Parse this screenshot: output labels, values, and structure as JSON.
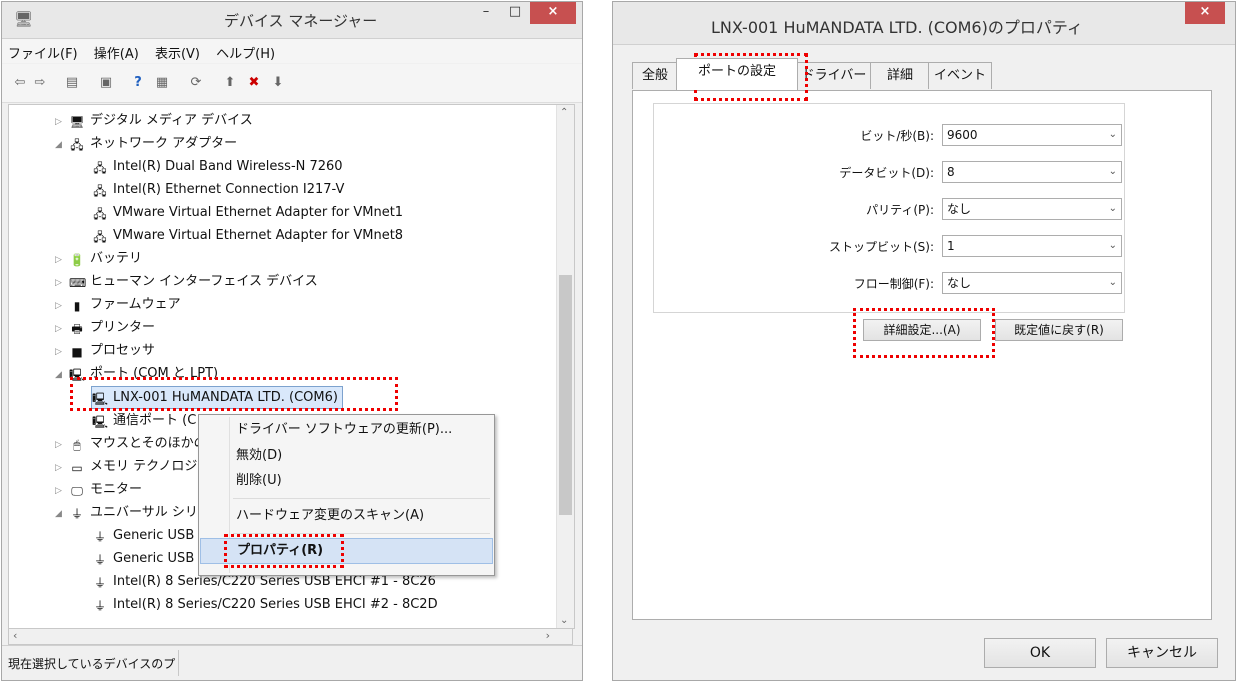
{
  "devmgr": {
    "title": "デバイス マネージャー",
    "min": "–",
    "max": "□",
    "close": "×",
    "menu": [
      "ファイル(F)",
      "操作(A)",
      "表示(V)",
      "ヘルプ(H)"
    ],
    "tree": [
      {
        "label": "デジタル メディア デバイス",
        "exp": "▷",
        "icon": "🖥"
      },
      {
        "label": "ネットワーク アダプター",
        "exp": "◢",
        "icon": "🖧"
      },
      {
        "label": "Intel(R) Dual Band Wireless-N 7260",
        "exp": "",
        "icon": "🖧"
      },
      {
        "label": "Intel(R) Ethernet Connection I217-V",
        "exp": "",
        "icon": "🖧"
      },
      {
        "label": "VMware Virtual Ethernet Adapter for VMnet1",
        "exp": "",
        "icon": "🖧"
      },
      {
        "label": "VMware Virtual Ethernet Adapter for VMnet8",
        "exp": "",
        "icon": "🖧"
      },
      {
        "label": "バッテリ",
        "exp": "▷",
        "icon": "🔋"
      },
      {
        "label": "ヒューマン インターフェイス デバイス",
        "exp": "▷",
        "icon": "⌨"
      },
      {
        "label": "ファームウェア",
        "exp": "▷",
        "icon": "▮"
      },
      {
        "label": "プリンター",
        "exp": "▷",
        "icon": "🖶"
      },
      {
        "label": "プロセッサ",
        "exp": "▷",
        "icon": "■"
      },
      {
        "label": "ポート (COM と LPT)",
        "exp": "◢",
        "icon": "🖳"
      },
      {
        "label": "LNX-001 HuMANDATA LTD. (COM6)",
        "exp": "",
        "icon": "🖳"
      },
      {
        "label": "通信ポート (C",
        "exp": "",
        "icon": "🖳"
      },
      {
        "label": "マウスとそのほかの",
        "exp": "▷",
        "icon": "🖱"
      },
      {
        "label": "メモリ テクノロジ デ",
        "exp": "▷",
        "icon": "▭"
      },
      {
        "label": "モニター",
        "exp": "▷",
        "icon": "🖵"
      },
      {
        "label": "ユニバーサル シリア",
        "exp": "◢",
        "icon": "⏚"
      },
      {
        "label": "Generic USB",
        "exp": "",
        "icon": "⏚"
      },
      {
        "label": "Generic USB Hub",
        "exp": "",
        "icon": "⏚"
      },
      {
        "label": "Intel(R) 8 Series/C220 Series USB EHCI #1 - 8C26",
        "exp": "",
        "icon": "⏚"
      },
      {
        "label": "Intel(R) 8 Series/C220 Series USB EHCI #2 - 8C2D",
        "exp": "",
        "icon": "⏚"
      }
    ],
    "context_menu": [
      "ドライバー ソフトウェアの更新(P)...",
      "無効(D)",
      "削除(U)",
      "ハードウェア変更のスキャン(A)",
      "プロパティ(R)"
    ],
    "status": "現在選択しているデバイスのプ"
  },
  "props": {
    "title": "LNX-001 HuMANDATA LTD. (COM6)のプロパティ",
    "close": "×",
    "tabs": [
      "全般",
      "ポートの設定",
      "ドライバー",
      "詳細",
      "イベント"
    ],
    "fields": [
      {
        "label": "ビット/秒(B):",
        "value": "9600"
      },
      {
        "label": "データビット(D):",
        "value": "8"
      },
      {
        "label": "パリティ(P):",
        "value": "なし"
      },
      {
        "label": "ストップビット(S):",
        "value": "1"
      },
      {
        "label": "フロー制御(F):",
        "value": "なし"
      }
    ],
    "advanced": "詳細設定...(A)",
    "defaults": "既定値に戻す(R)",
    "ok": "OK",
    "cancel": "キャンセル"
  }
}
